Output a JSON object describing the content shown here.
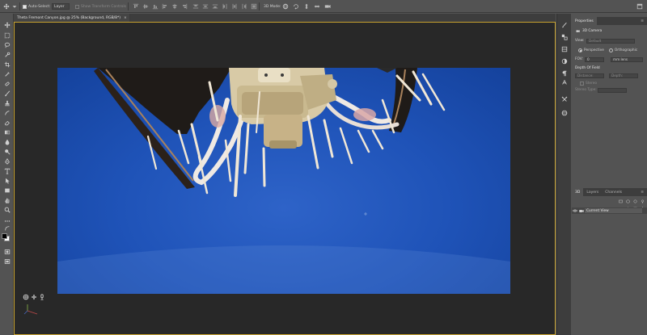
{
  "options_bar": {
    "auto_select_label": "Auto-Select:",
    "auto_select_target": "Layer",
    "show_transform_controls": "Show Transform Controls",
    "mode_3d": "3D Mode:"
  },
  "document": {
    "tab_title": "Theta Fremont Canyon.jpg @ 25% (Background, RGB/8*)"
  },
  "properties": {
    "tab_label": "Properties",
    "section_title": "3D Camera",
    "view_label": "View:",
    "view_value": "Default",
    "perspective_label": "Perspective",
    "orthographic_label": "Orthographic",
    "projection_selected": "perspective",
    "fov_label": "FOV:",
    "fov_value": "0",
    "lens_value": "mm lens",
    "depth_of_field_label": "Depth Of Field",
    "distance_label": "Distance:",
    "depth_label": "Depth:",
    "stereo_label": "Stereo",
    "stereo_type_label": "Stereo Type:"
  },
  "layers_panel": {
    "tabs": [
      "3D",
      "Layers",
      "Channels"
    ],
    "active_tab": "3D",
    "rows": [
      {
        "name": "Current View"
      }
    ]
  },
  "colors": {
    "accent_border": "#c7a22f",
    "sky_center": "#2e63c8",
    "sky_edge": "#123e96",
    "app_bg": "#535353",
    "workspace_bg": "#282828"
  }
}
